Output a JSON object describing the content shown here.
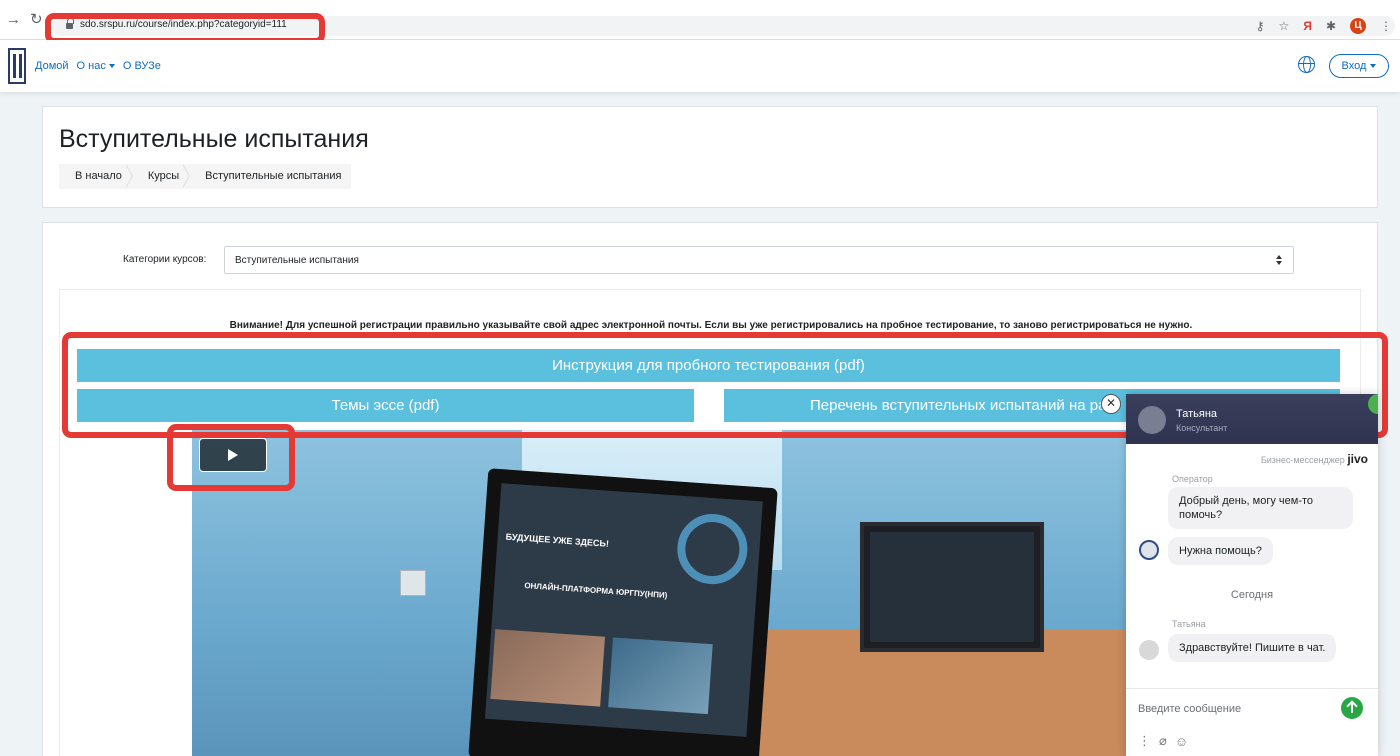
{
  "browser": {
    "url": "sdo.srspu.ru/course/index.php?categoryid=111",
    "yandex_label": "Я",
    "profile_letter": "Ц"
  },
  "navbar": {
    "links": [
      "Домой",
      "О нас",
      "О ВУЗе"
    ],
    "login_label": "Вход"
  },
  "header": {
    "title": "Вступительные испытания",
    "breadcrumb": [
      "В начало",
      "Курсы",
      "Вступительные испытания"
    ]
  },
  "main": {
    "category_label": "Категории курсов:",
    "category_value": "Вступительные испытания",
    "notice": "Внимание! Для успешной регистрации правильно указывайте свой адрес электронной почты. Если вы уже регистрировались на пробное тестирование, то заново регистрироваться не нужно.",
    "btn_instruction": "Инструкция для пробного тестирования (pdf)",
    "btn_essay": "Темы эссе (pdf)",
    "btn_list": "Перечень вступительных испытаний на ра",
    "video_text_1": "БУДУЩЕЕ УЖЕ ЗДЕСЬ!",
    "video_text_2": "ОНЛАЙН-ПЛАТФОРМА ЮРГПУ(НПИ)"
  },
  "chat": {
    "agent_name": "Татьяна",
    "agent_role": "Консультант",
    "brand_prefix": "Бизнес-мессенджер",
    "brand_name": "jivo",
    "operator_label": "Оператор",
    "msg_1": "Добрый день, могу чем-то помочь?",
    "msg_2": "Нужна помощь?",
    "day_label": "Сегодня",
    "sender_label": "Татьяна",
    "msg_3": "Здравствуйте! Пишите в чат.",
    "input_placeholder": "Введите сообщение"
  },
  "colors": {
    "accent": "#0f6cbf",
    "button": "#5bc0de",
    "highlight": "#e53935",
    "chat_header": "#2f3350",
    "send": "#28a745"
  }
}
